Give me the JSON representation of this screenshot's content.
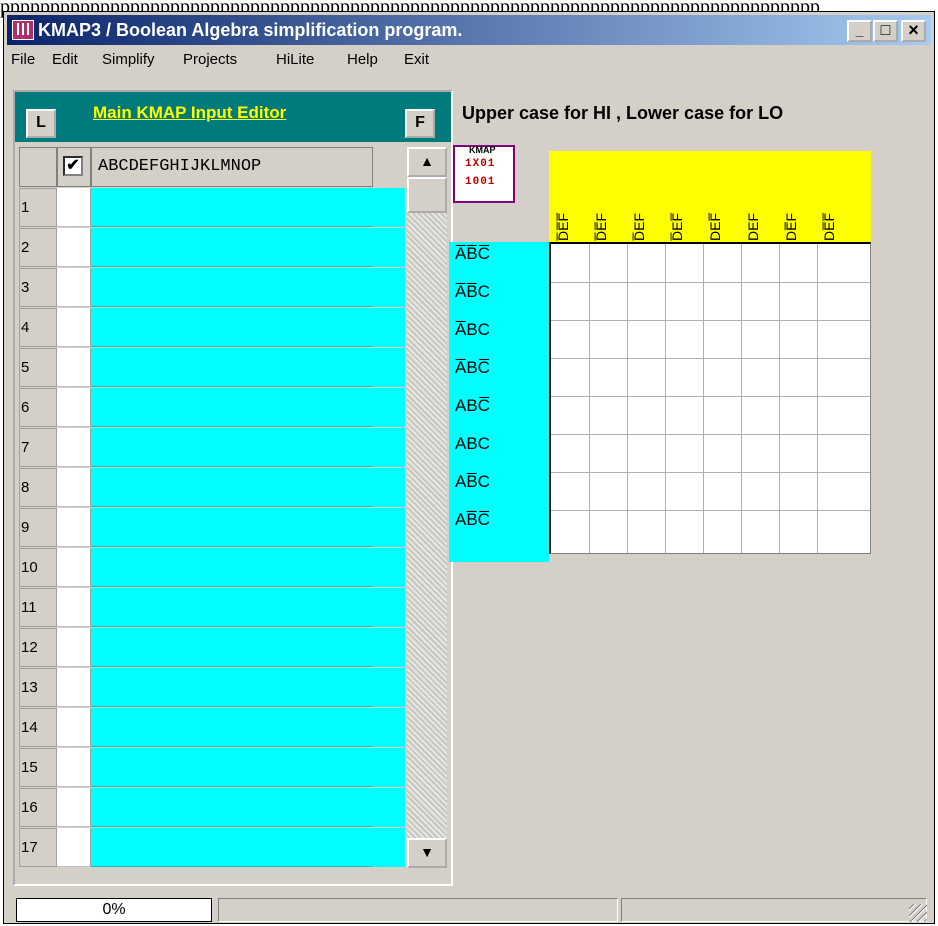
{
  "caption": "pppppppppppppppppppppppppppppppppppppppppppppppppppppppppppppppppppppppppppppppppp",
  "window": {
    "title": "KMAP3 / Boolean Algebra simplification program.",
    "controls": {
      "minimize": "_",
      "maximize": "□",
      "close": "×"
    }
  },
  "menu": [
    "File",
    "Edit",
    "Simplify",
    "Projects",
    "HiLite",
    "Help",
    "Exit"
  ],
  "editor": {
    "left_button": "L",
    "title": "Main  KMAP Input Editor",
    "right_button": "F",
    "header_check": "✔",
    "variables": "ABCDEFGHIJKLMNOP",
    "rows": [
      "1",
      "2",
      "3",
      "4",
      "5",
      "6",
      "7",
      "8",
      "9",
      "10",
      "11",
      "12",
      "13",
      "14",
      "15",
      "16",
      "17"
    ],
    "scroll_up": "▲",
    "scroll_down": "▼"
  },
  "hint": "Upper case for HI ,  Lower case for LO",
  "kmap": {
    "icon": {
      "label": "KMAP",
      "rows": [
        "1X01",
        "1001"
      ]
    },
    "columns": [
      "D̅E̅F̅",
      "D̅E̅F",
      "D̅EF",
      "D̅EF̅",
      "DEF̅",
      "DEF",
      "DE̅F",
      "DE̅F̅"
    ],
    "rows": [
      "A̅B̅C̅",
      "A̅B̅C",
      "A̅BC",
      "A̅BC̅",
      "ABC̅",
      "ABC",
      "AB̅C",
      "AB̅C̅"
    ]
  },
  "status": {
    "progress": "0%",
    "progress_value": 0
  }
}
